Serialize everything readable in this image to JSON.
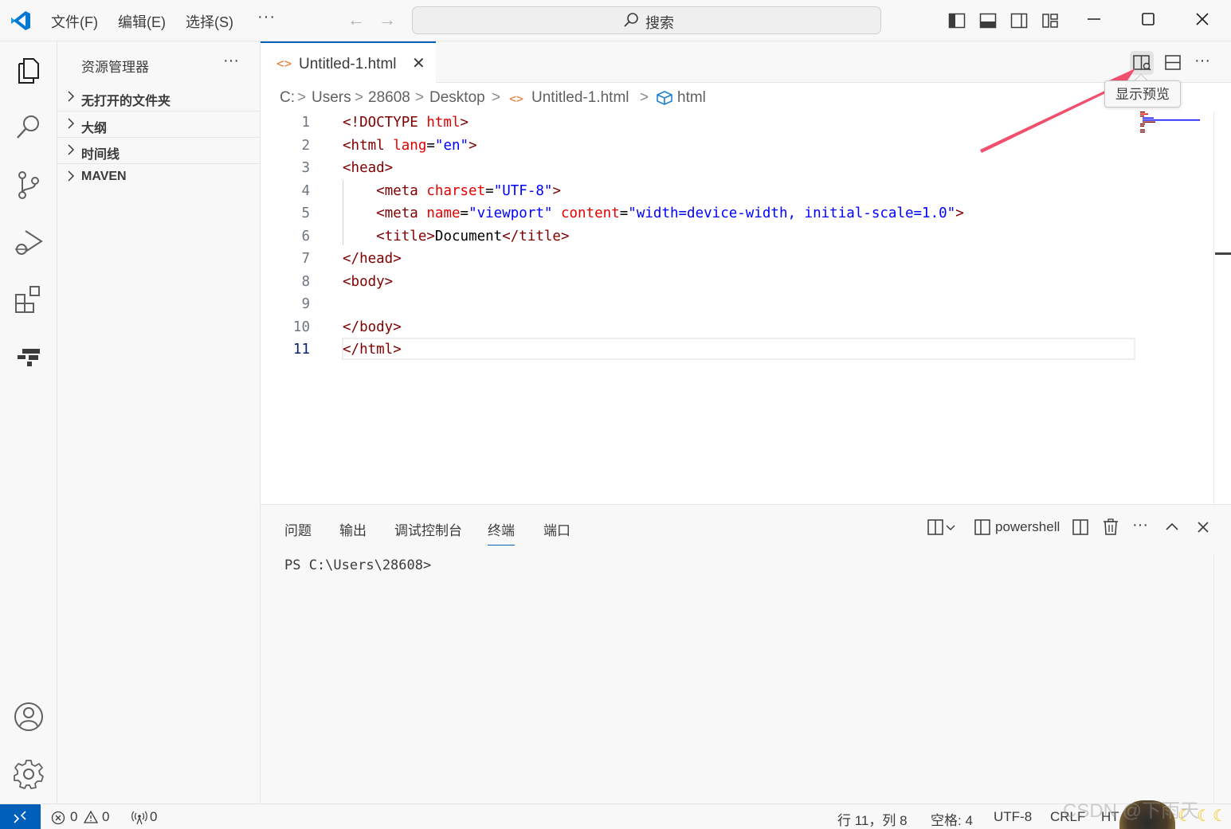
{
  "titlebar": {
    "menus": [
      "文件(F)",
      "编辑(E)",
      "选择(S)"
    ],
    "more": "···",
    "back": "←",
    "forward": "→",
    "search_label": "搜索"
  },
  "sidebar": {
    "title": "资源管理器",
    "more": "···",
    "sections": [
      "无打开的文件夹",
      "大纲",
      "时间线",
      "MAVEN"
    ]
  },
  "editor": {
    "tab": {
      "icon": "<>",
      "label": "Untitled-1.html",
      "close": "✕"
    },
    "more": "···",
    "tooltip": "显示预览",
    "breadcrumb": [
      "C:",
      "Users",
      "28608",
      "Desktop",
      "Untitled-1.html",
      "html"
    ],
    "breadcrumb_sep": ">",
    "breadcrumb_file_icon": "<>",
    "current_line": 11,
    "lines": [
      {
        "n": "1",
        "tokens": [
          [
            "t-tag",
            "<!DOCTYPE "
          ],
          [
            "t-attr",
            "html"
          ],
          [
            "t-tag",
            ">"
          ]
        ]
      },
      {
        "n": "2",
        "tokens": [
          [
            "t-tag",
            "<html "
          ],
          [
            "t-attr",
            "lang"
          ],
          [
            "t-txt",
            "="
          ],
          [
            "t-val",
            "\"en\""
          ],
          [
            "t-tag",
            ">"
          ]
        ]
      },
      {
        "n": "3",
        "tokens": [
          [
            "t-tag",
            "<head>"
          ]
        ]
      },
      {
        "n": "4",
        "tokens": [
          [
            "t-txt",
            "    "
          ],
          [
            "t-tag",
            "<meta "
          ],
          [
            "t-attr",
            "charset"
          ],
          [
            "t-txt",
            "="
          ],
          [
            "t-val",
            "\"UTF-8\""
          ],
          [
            "t-tag",
            ">"
          ]
        ]
      },
      {
        "n": "5",
        "tokens": [
          [
            "t-txt",
            "    "
          ],
          [
            "t-tag",
            "<meta "
          ],
          [
            "t-attr",
            "name"
          ],
          [
            "t-txt",
            "="
          ],
          [
            "t-val",
            "\"viewport\" "
          ],
          [
            "t-attr",
            "content"
          ],
          [
            "t-txt",
            "="
          ],
          [
            "t-val",
            "\"width=device-width, initial-scale=1.0\""
          ],
          [
            "t-tag",
            ">"
          ]
        ]
      },
      {
        "n": "6",
        "tokens": [
          [
            "t-txt",
            "    "
          ],
          [
            "t-tag",
            "<title>"
          ],
          [
            "t-txt",
            "Document"
          ],
          [
            "t-tag",
            "</title>"
          ]
        ]
      },
      {
        "n": "7",
        "tokens": [
          [
            "t-tag",
            "</head>"
          ]
        ]
      },
      {
        "n": "8",
        "tokens": [
          [
            "t-tag",
            "<body>"
          ]
        ]
      },
      {
        "n": "9",
        "tokens": []
      },
      {
        "n": "10",
        "tokens": [
          [
            "t-tag",
            "</body>"
          ]
        ]
      },
      {
        "n": "11",
        "tokens": [
          [
            "t-tag",
            "</html>"
          ]
        ]
      }
    ]
  },
  "panel": {
    "tabs": [
      "问题",
      "输出",
      "调试控制台",
      "终端",
      "端口"
    ],
    "active_tab": "终端",
    "shell": "powershell",
    "more": "···",
    "terminal_prompt": "PS C:\\Users\\28608>"
  },
  "statusbar": {
    "errors": "0",
    "warnings": "0",
    "ports": "0",
    "position": "行 11，列 8",
    "spaces": "空格: 4",
    "encoding": "UTF-8",
    "eol": "CRLF",
    "language": "HT"
  },
  "watermark": "CSDN @下雨天",
  "colors": {
    "accent": "#005fb8",
    "tag": "#800000",
    "attribute": "#e50000",
    "string": "#0000ff",
    "annotation_arrow": "#f0506e"
  },
  "icons": {
    "activity": [
      "explorer-icon",
      "search-icon",
      "source-control-icon",
      "run-debug-icon",
      "extensions-icon",
      "remote-explorer-icon",
      "account-icon",
      "settings-gear-icon"
    ]
  }
}
